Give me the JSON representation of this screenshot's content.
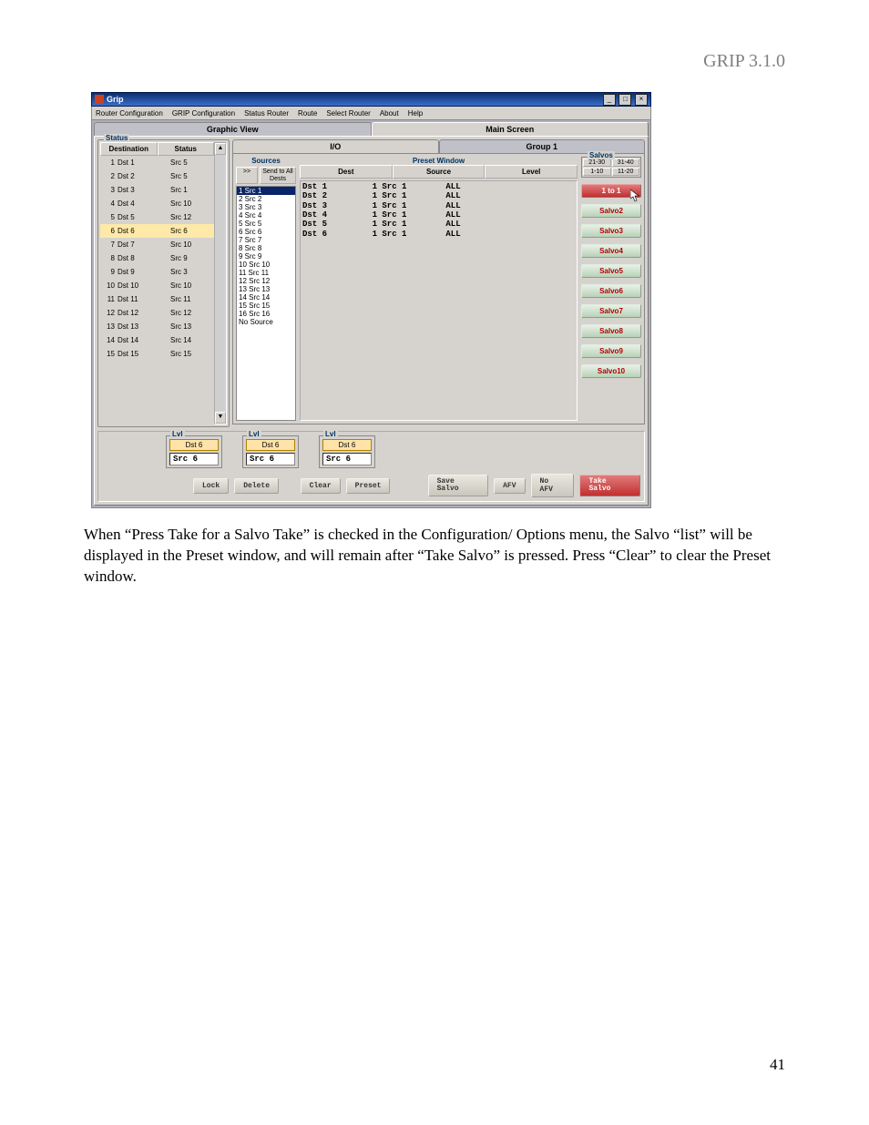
{
  "header": "GRIP 3.1.0",
  "page_number": "41",
  "body_text": "When “Press Take for a Salvo Take” is checked in the Configuration/ Options menu, the Salvo “list” will be displayed in the Preset window, and will remain after “Take Salvo” is pressed. Press “Clear” to clear the Preset window.",
  "window": {
    "title": "Grip"
  },
  "menu": [
    "Router Configuration",
    "GRIP Configuration",
    "Status Router",
    "Route",
    "Select Router",
    "About",
    "Help"
  ],
  "tabs": {
    "left": "Graphic View",
    "right": "Main Screen"
  },
  "status": {
    "group": "Status",
    "headers": {
      "dest": "Destination",
      "stat": "Status"
    },
    "selected_index": 5,
    "rows": [
      {
        "n": "1",
        "d": "Dst 1",
        "s": "Src 5"
      },
      {
        "n": "2",
        "d": "Dst 2",
        "s": "Src 5"
      },
      {
        "n": "3",
        "d": "Dst 3",
        "s": "Src 1"
      },
      {
        "n": "4",
        "d": "Dst 4",
        "s": "Src 10"
      },
      {
        "n": "5",
        "d": "Dst 5",
        "s": "Src 12"
      },
      {
        "n": "6",
        "d": "Dst 6",
        "s": "Src 6"
      },
      {
        "n": "7",
        "d": "Dst 7",
        "s": "Src 10"
      },
      {
        "n": "8",
        "d": "Dst 8",
        "s": "Src 9"
      },
      {
        "n": "9",
        "d": "Dst 9",
        "s": "Src 3"
      },
      {
        "n": "10",
        "d": "Dst 10",
        "s": "Src 10"
      },
      {
        "n": "11",
        "d": "Dst 11",
        "s": "Src 11"
      },
      {
        "n": "12",
        "d": "Dst 12",
        "s": "Src 12"
      },
      {
        "n": "13",
        "d": "Dst 13",
        "s": "Src 13"
      },
      {
        "n": "14",
        "d": "Dst 14",
        "s": "Src 14"
      },
      {
        "n": "15",
        "d": "Dst 15",
        "s": "Src 15"
      }
    ]
  },
  "io": {
    "tabs": {
      "io": "I/O",
      "grp": "Group 1"
    },
    "sources": {
      "title": "Sources",
      "send_btn": ">>",
      "send_all": "Send to All Dests",
      "selected_index": 0,
      "list": [
        "1 Src 1",
        "2 Src 2",
        "3 Src 3",
        "4 Src 4",
        "5 Src 5",
        "6 Src 6",
        "7 Src 7",
        "8 Src 8",
        "9 Src 9",
        "10 Src 10",
        "11 Src 11",
        "12 Src 12",
        "13 Src 13",
        "14 Src 14",
        "15 Src 15",
        "16 Src 16",
        "No Source"
      ]
    },
    "preset": {
      "title": "Preset Window",
      "headers": {
        "dest": "Dest",
        "source": "Source",
        "level": "Level"
      },
      "rows": [
        {
          "dest": "Dst  1",
          "n": "1",
          "src": "Src  1",
          "lvl": "ALL"
        },
        {
          "dest": "Dst  2",
          "n": "1",
          "src": "Src  1",
          "lvl": "ALL"
        },
        {
          "dest": "Dst  3",
          "n": "1",
          "src": "Src  1",
          "lvl": "ALL"
        },
        {
          "dest": "Dst  4",
          "n": "1",
          "src": "Src  1",
          "lvl": "ALL"
        },
        {
          "dest": "Dst  5",
          "n": "1",
          "src": "Src  1",
          "lvl": "ALL"
        },
        {
          "dest": "Dst  6",
          "n": "1",
          "src": "Src  1",
          "lvl": "ALL"
        }
      ]
    },
    "salvos": {
      "title": "Salvos",
      "ranges": [
        "21-30",
        "31-40",
        "1-10",
        "11-20"
      ],
      "buttons": [
        "1 to 1",
        "Salvo2",
        "Salvo3",
        "Salvo4",
        "Salvo5",
        "Salvo6",
        "Salvo7",
        "Salvo8",
        "Salvo9",
        "Salvo10"
      ]
    }
  },
  "lvl": {
    "title": "Lvl",
    "dst": "Dst 6",
    "src": "Src  6"
  },
  "buttons": {
    "lock": "Lock",
    "delete": "Delete",
    "clear": "Clear",
    "preset": "Preset",
    "save": "Save Salvo",
    "afv": "AFV",
    "noafv": "No AFV",
    "take": "Take Salvo"
  }
}
